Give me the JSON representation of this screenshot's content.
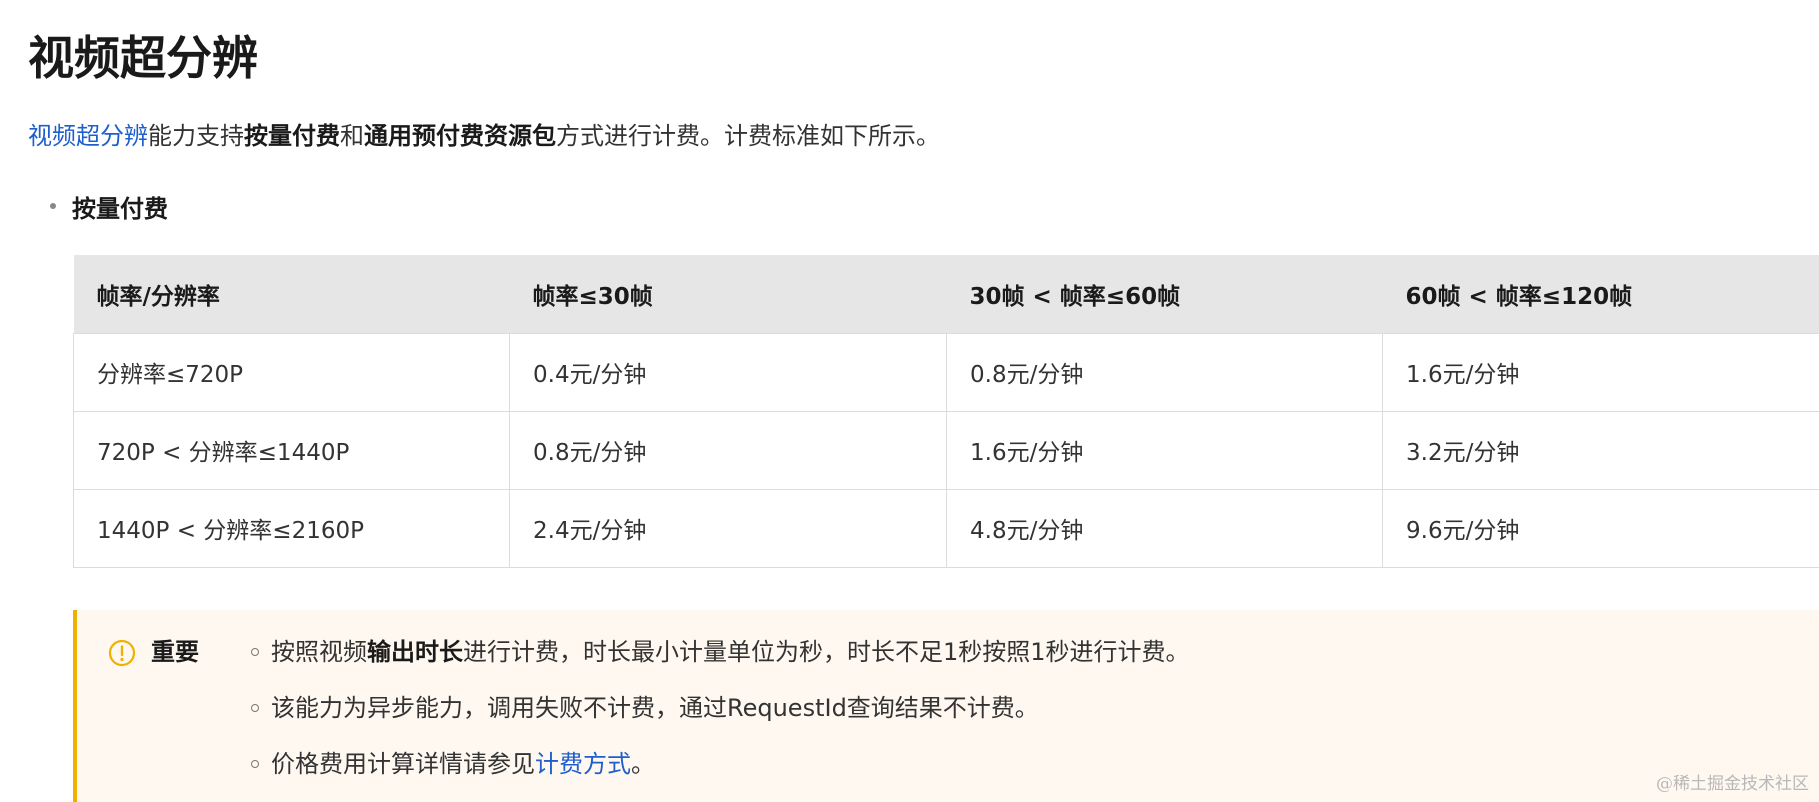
{
  "title": "视频超分辨",
  "intro": {
    "link": "视频超分辨",
    "t1": "能力支持",
    "b1": "按量付费",
    "t2": "和",
    "b2": "通用预付费资源包",
    "t3": "方式进行计费。计费标准如下所示。"
  },
  "section": {
    "bullet": "按量付费"
  },
  "table": {
    "headers": [
      "帧率/分辨率",
      "帧率≤30帧",
      "30帧 < 帧率≤60帧",
      "60帧 < 帧率≤120帧"
    ],
    "rows": [
      [
        "分辨率≤720P",
        "0.4元/分钟",
        "0.8元/分钟",
        "1.6元/分钟"
      ],
      [
        "720P < 分辨率≤1440P",
        "0.8元/分钟",
        "1.6元/分钟",
        "3.2元/分钟"
      ],
      [
        "1440P < 分辨率≤2160P",
        "2.4元/分钟",
        "4.8元/分钟",
        "9.6元/分钟"
      ]
    ]
  },
  "notice": {
    "label": "重要",
    "item1": {
      "pre": "按照视频",
      "bold": "输出时长",
      "post": "进行计费，时长最小计量单位为秒，时长不足1秒按照1秒进行计费。"
    },
    "item2": "该能力为异步能力，调用失败不计费，通过RequestId查询结果不计费。",
    "item3": {
      "pre": "价格费用计算详情请参见",
      "link": "计费方式",
      "post": "。"
    },
    "accent_color": "#f0b000",
    "background_color": "#fff8f0",
    "icon": "warning-circle-icon"
  },
  "watermark": "@稀土掘金技术社区",
  "colors": {
    "link": "#1f5fcc",
    "table_header_bg": "#e6e6e6"
  }
}
